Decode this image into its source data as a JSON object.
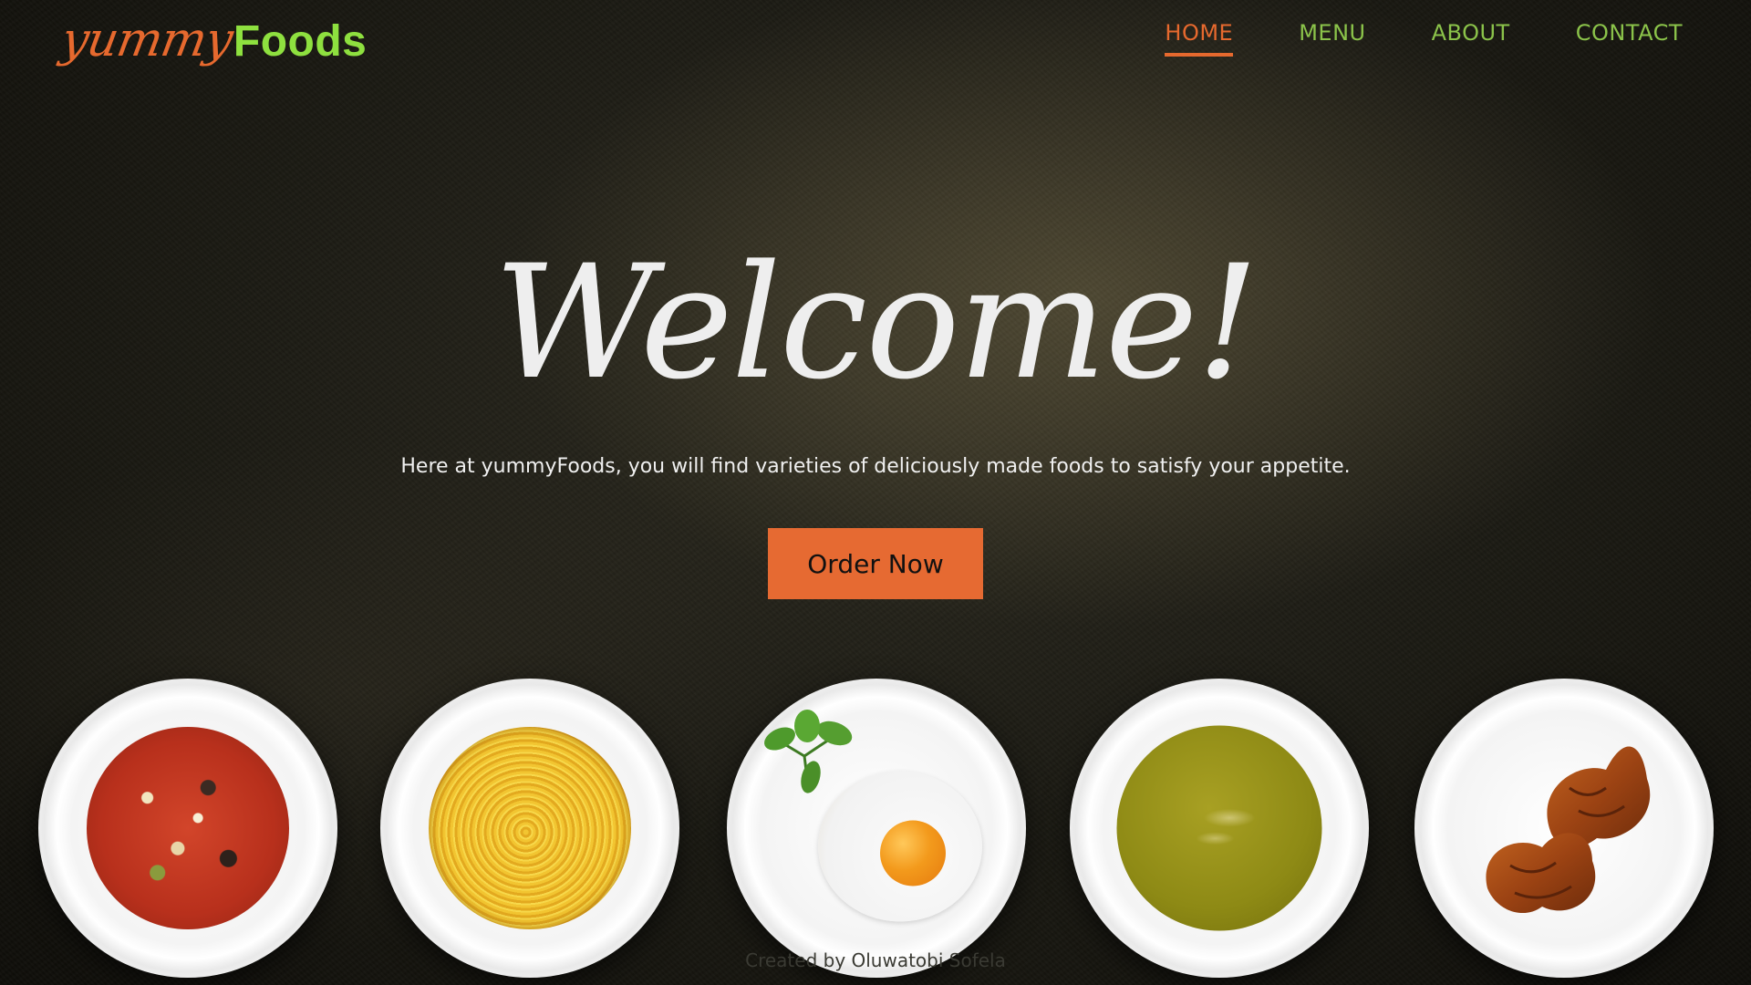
{
  "brand": {
    "script": "yummy",
    "bold": "Foods"
  },
  "nav": {
    "items": [
      {
        "label": "HOME",
        "active": true
      },
      {
        "label": "MENU",
        "active": false
      },
      {
        "label": "ABOUT",
        "active": false
      },
      {
        "label": "CONTACT",
        "active": false
      }
    ]
  },
  "hero": {
    "title": "Welcome!",
    "subtitle": "Here at yummyFoods, you will find varieties of deliciously made foods to satisfy your appetite.",
    "cta_label": "Order Now"
  },
  "plates": [
    {
      "dish": "vegetable-soup"
    },
    {
      "dish": "spaghetti"
    },
    {
      "dish": "fried-egg"
    },
    {
      "dish": "pea-soup"
    },
    {
      "dish": "croissants"
    }
  ],
  "footer": {
    "credit": "Created by Oluwatobi Sofela"
  },
  "colors": {
    "accent_orange": "#e6692e",
    "accent_green": "#8bc34a",
    "logo_green": "#8ee03f",
    "button_bg": "#e66a32"
  }
}
